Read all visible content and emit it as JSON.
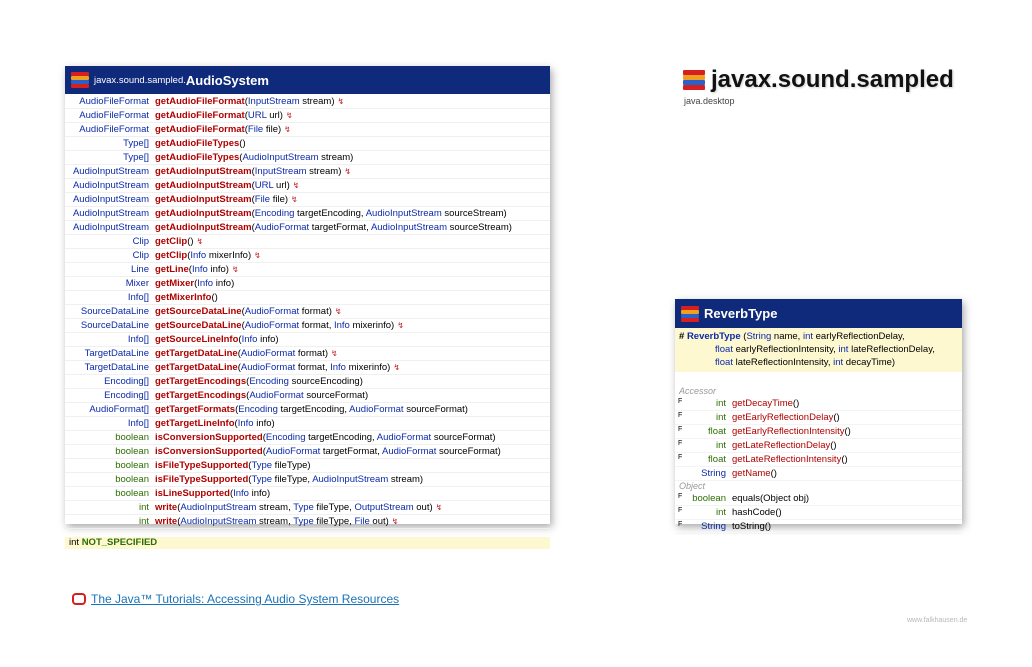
{
  "package": {
    "title": "javax.sound.sampled",
    "module": "java.desktop"
  },
  "audio_system": {
    "package_prefix": "javax.sound.sampled.",
    "class_name": "AudioSystem",
    "methods": [
      {
        "ret": "AudioFileFormat",
        "kind": "type",
        "name": "getAudioFileFormat",
        "params": [
          [
            "InputStream",
            "link"
          ],
          [
            " stream)",
            ""
          ]
        ],
        "sig": true
      },
      {
        "ret": "AudioFileFormat",
        "kind": "type",
        "name": "getAudioFileFormat",
        "params": [
          [
            "URL",
            "link"
          ],
          [
            " url)",
            ""
          ]
        ],
        "sig": true
      },
      {
        "ret": "AudioFileFormat",
        "kind": "type",
        "name": "getAudioFileFormat",
        "params": [
          [
            "File",
            "link"
          ],
          [
            " file)",
            ""
          ]
        ],
        "sig": true
      },
      {
        "ret": "Type[]",
        "kind": "type",
        "name": "getAudioFileTypes",
        "params": [
          [
            "()",
            ""
          ]
        ],
        "sig": false,
        "noparen": true
      },
      {
        "ret": "Type[]",
        "kind": "type",
        "name": "getAudioFileTypes",
        "params": [
          [
            "AudioInputStream",
            "link"
          ],
          [
            " stream)",
            ""
          ]
        ],
        "sig": false
      },
      {
        "ret": "AudioInputStream",
        "kind": "type",
        "name": "getAudioInputStream",
        "params": [
          [
            "InputStream",
            "link"
          ],
          [
            " stream)",
            ""
          ]
        ],
        "sig": true
      },
      {
        "ret": "AudioInputStream",
        "kind": "type",
        "name": "getAudioInputStream",
        "params": [
          [
            "URL",
            "link"
          ],
          [
            " url)",
            ""
          ]
        ],
        "sig": true
      },
      {
        "ret": "AudioInputStream",
        "kind": "type",
        "name": "getAudioInputStream",
        "params": [
          [
            "File",
            "link"
          ],
          [
            " file)",
            ""
          ]
        ],
        "sig": true
      },
      {
        "ret": "AudioInputStream",
        "kind": "type",
        "name": "getAudioInputStream",
        "params": [
          [
            "Encoding",
            "link"
          ],
          [
            " targetEncoding, ",
            ""
          ],
          [
            "AudioInputStream",
            "link"
          ],
          [
            " sourceStream)",
            ""
          ]
        ],
        "sig": false
      },
      {
        "ret": "AudioInputStream",
        "kind": "type",
        "name": "getAudioInputStream",
        "params": [
          [
            "AudioFormat",
            "link"
          ],
          [
            " targetFormat, ",
            ""
          ],
          [
            "AudioInputStream",
            "link"
          ],
          [
            " sourceStream)",
            ""
          ]
        ],
        "sig": false
      },
      {
        "ret": "Clip",
        "kind": "type",
        "name": "getClip",
        "params": [
          [
            "()",
            ""
          ]
        ],
        "sig": true,
        "noparen": true
      },
      {
        "ret": "Clip",
        "kind": "type",
        "name": "getClip",
        "params": [
          [
            "Info",
            "link"
          ],
          [
            " mixerInfo)",
            ""
          ]
        ],
        "sig": true
      },
      {
        "ret": "Line",
        "kind": "type",
        "name": "getLine",
        "params": [
          [
            "Info",
            "link"
          ],
          [
            " info)",
            ""
          ]
        ],
        "sig": true
      },
      {
        "ret": "Mixer",
        "kind": "type",
        "name": "getMixer",
        "params": [
          [
            "Info",
            "link"
          ],
          [
            " info)",
            ""
          ]
        ],
        "sig": false
      },
      {
        "ret": "Info[]",
        "kind": "type",
        "name": "getMixerInfo",
        "params": [
          [
            "()",
            ""
          ]
        ],
        "sig": false,
        "noparen": true
      },
      {
        "ret": "SourceDataLine",
        "kind": "type",
        "name": "getSourceDataLine",
        "params": [
          [
            "AudioFormat",
            "link"
          ],
          [
            " format)",
            ""
          ]
        ],
        "sig": true
      },
      {
        "ret": "SourceDataLine",
        "kind": "type",
        "name": "getSourceDataLine",
        "params": [
          [
            "AudioFormat",
            "link"
          ],
          [
            " format, ",
            ""
          ],
          [
            "Info",
            "link"
          ],
          [
            " mixerinfo)",
            ""
          ]
        ],
        "sig": true
      },
      {
        "ret": "Info[]",
        "kind": "type",
        "name": "getSourceLineInfo",
        "params": [
          [
            "Info",
            "link"
          ],
          [
            " info)",
            ""
          ]
        ],
        "sig": false
      },
      {
        "ret": "TargetDataLine",
        "kind": "type",
        "name": "getTargetDataLine",
        "params": [
          [
            "AudioFormat",
            "link"
          ],
          [
            " format)",
            ""
          ]
        ],
        "sig": true
      },
      {
        "ret": "TargetDataLine",
        "kind": "type",
        "name": "getTargetDataLine",
        "params": [
          [
            "AudioFormat",
            "link"
          ],
          [
            " format, ",
            ""
          ],
          [
            "Info",
            "link"
          ],
          [
            " mixerinfo)",
            ""
          ]
        ],
        "sig": true
      },
      {
        "ret": "Encoding[]",
        "kind": "type",
        "name": "getTargetEncodings",
        "params": [
          [
            "Encoding",
            "link"
          ],
          [
            " sourceEncoding)",
            ""
          ]
        ],
        "sig": false
      },
      {
        "ret": "Encoding[]",
        "kind": "type",
        "name": "getTargetEncodings",
        "params": [
          [
            "AudioFormat",
            "link"
          ],
          [
            " sourceFormat)",
            ""
          ]
        ],
        "sig": false
      },
      {
        "ret": "AudioFormat[]",
        "kind": "type",
        "name": "getTargetFormats",
        "params": [
          [
            "Encoding",
            "link"
          ],
          [
            " targetEncoding, ",
            ""
          ],
          [
            "AudioFormat",
            "link"
          ],
          [
            " sourceFormat)",
            ""
          ]
        ],
        "sig": false
      },
      {
        "ret": "Info[]",
        "kind": "type",
        "name": "getTargetLineInfo",
        "params": [
          [
            "Info",
            "link"
          ],
          [
            " info)",
            ""
          ]
        ],
        "sig": false
      },
      {
        "ret": "boolean",
        "kind": "prim",
        "name": "isConversionSupported",
        "params": [
          [
            "Encoding",
            "link"
          ],
          [
            " targetEncoding, ",
            ""
          ],
          [
            "AudioFormat",
            "link"
          ],
          [
            " sourceFormat)",
            ""
          ]
        ],
        "sig": false
      },
      {
        "ret": "boolean",
        "kind": "prim",
        "name": "isConversionSupported",
        "params": [
          [
            "AudioFormat",
            "link"
          ],
          [
            " targetFormat, ",
            ""
          ],
          [
            "AudioFormat",
            "link"
          ],
          [
            " sourceFormat)",
            ""
          ]
        ],
        "sig": false
      },
      {
        "ret": "boolean",
        "kind": "prim",
        "name": "isFileTypeSupported",
        "params": [
          [
            "Type",
            "link"
          ],
          [
            " fileType)",
            ""
          ]
        ],
        "sig": false
      },
      {
        "ret": "boolean",
        "kind": "prim",
        "name": "isFileTypeSupported",
        "params": [
          [
            "Type",
            "link"
          ],
          [
            " fileType, ",
            ""
          ],
          [
            "AudioInputStream",
            "link"
          ],
          [
            " stream)",
            ""
          ]
        ],
        "sig": false
      },
      {
        "ret": "boolean",
        "kind": "prim",
        "name": "isLineSupported",
        "params": [
          [
            "Info",
            "link"
          ],
          [
            " info)",
            ""
          ]
        ],
        "sig": false
      },
      {
        "ret": "int",
        "kind": "prim",
        "name": "write",
        "params": [
          [
            "AudioInputStream",
            "link"
          ],
          [
            " stream, ",
            ""
          ],
          [
            "Type",
            "link"
          ],
          [
            " fileType, ",
            ""
          ],
          [
            "OutputStream",
            "link"
          ],
          [
            " out)",
            ""
          ]
        ],
        "sig": true
      },
      {
        "ret": "int",
        "kind": "prim",
        "name": "write",
        "params": [
          [
            "AudioInputStream",
            "link"
          ],
          [
            " stream, ",
            ""
          ],
          [
            "Type",
            "link"
          ],
          [
            " fileType, ",
            ""
          ],
          [
            "File",
            "link"
          ],
          [
            " out)",
            ""
          ]
        ],
        "sig": true
      }
    ],
    "constant": {
      "type": "int",
      "name": "NOT_SPECIFIED"
    }
  },
  "reverb_type": {
    "class_name": "ReverbType",
    "constructor": {
      "marker": "#",
      "name": "ReverbType",
      "lines": [
        [
          [
            "(",
            ""
          ],
          [
            "String",
            "link"
          ],
          [
            " name, ",
            ""
          ],
          [
            "int",
            "link"
          ],
          [
            " earlyReflectionDelay,",
            ""
          ]
        ],
        [
          [
            "float",
            "link"
          ],
          [
            " earlyReflectionIntensity, ",
            ""
          ],
          [
            "int",
            "link"
          ],
          [
            " lateReflectionDelay,",
            ""
          ]
        ],
        [
          [
            "float",
            "link"
          ],
          [
            " lateReflectionIntensity, ",
            ""
          ],
          [
            "int",
            "link"
          ],
          [
            " decayTime)",
            ""
          ]
        ]
      ]
    },
    "sections": [
      {
        "label": "Accessor",
        "items": [
          {
            "mark": "F",
            "ret": "int",
            "name": "getDecayTime",
            "params": "()"
          },
          {
            "mark": "F",
            "ret": "int",
            "name": "getEarlyReflectionDelay",
            "params": "()"
          },
          {
            "mark": "F",
            "ret": "float",
            "name": "getEarlyReflectionIntensity",
            "params": "()"
          },
          {
            "mark": "F",
            "ret": "int",
            "name": "getLateReflectionDelay",
            "params": "()"
          },
          {
            "mark": "F",
            "ret": "float",
            "name": "getLateReflectionIntensity",
            "params": "()"
          },
          {
            "mark": "",
            "ret": "String",
            "name": "getName",
            "params": "()"
          }
        ]
      },
      {
        "label": "Object",
        "items": [
          {
            "mark": "F",
            "ret": "boolean",
            "name": "equals",
            "params": "(Object obj)",
            "plain": true
          },
          {
            "mark": "F",
            "ret": "int",
            "name": "hashCode",
            "params": "()",
            "plain": true
          },
          {
            "mark": "F",
            "ret": "String",
            "name": "toString",
            "params": "()",
            "plain": true
          }
        ]
      }
    ]
  },
  "tutorial_link": "The Java™ Tutorials: Accessing Audio System Resources",
  "footer": "www.falkhausen.de",
  "colors": {
    "header": "#0f2a7a",
    "method": "#b00000",
    "type": "#0b2aa8",
    "primitive": "#2c6e00",
    "highlight": "#fdf8d0"
  },
  "icons": {
    "package": "package-stack-icon",
    "signature": "throws-icon",
    "tutorial": "oracle-icon"
  }
}
